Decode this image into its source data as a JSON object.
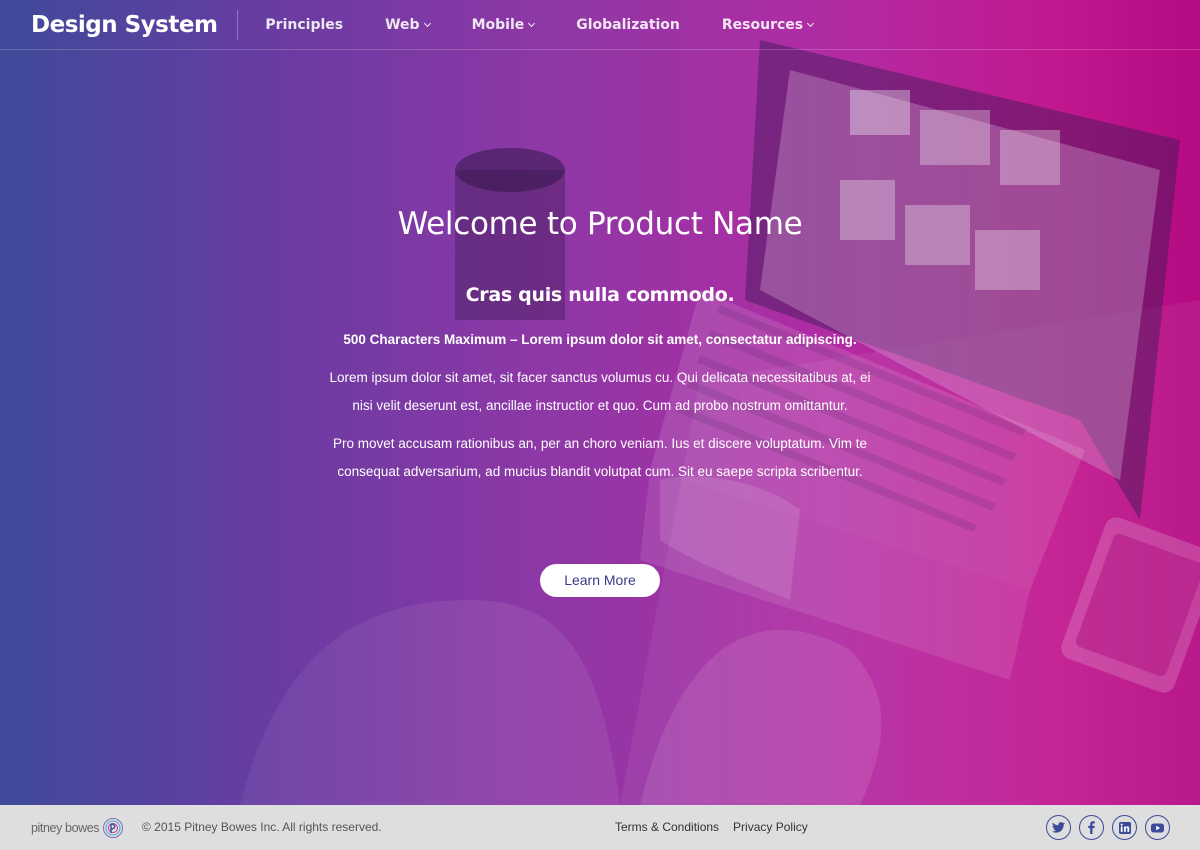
{
  "nav": {
    "brand": "Design System",
    "items": [
      {
        "label": "Principles",
        "dropdown": false
      },
      {
        "label": "Web",
        "dropdown": true
      },
      {
        "label": "Mobile",
        "dropdown": true
      },
      {
        "label": "Globalization",
        "dropdown": false
      },
      {
        "label": "Resources",
        "dropdown": true
      }
    ]
  },
  "hero": {
    "title": "Welcome to Product Name",
    "subtitle": "Cras quis nulla commodo.",
    "lead": "500 Characters Maximum – Lorem ipsum dolor sit amet, consectatur adipiscing.",
    "paragraph1": "Lorem ipsum dolor sit amet, sit facer sanctus volumus cu. Qui delicata necessitatibus at, ei nisi velit deserunt est, ancillae instructior et quo. Cum ad probo nostrum omittantur.",
    "paragraph2": "Pro movet accusam rationibus an, per an choro veniam. Ius et discere voluptatum. Vim te consequat adversarium, ad mucius blandit volutpat cum. Sit eu saepe scripta scribentur.",
    "button": "Learn More"
  },
  "footer": {
    "logo_text": "pitney bowes",
    "copyright": "© 2015 Pitney Bowes Inc. All rights reserved.",
    "links": [
      "Terms & Conditions",
      "Privacy Policy"
    ],
    "social": [
      "twitter-icon",
      "facebook-icon",
      "linkedin-icon",
      "youtube-icon"
    ],
    "social_color": "#3b4a9a"
  },
  "colors": {
    "gradient_start": "#3f4a9a",
    "gradient_end": "#b40a82",
    "footer_bg": "#dedede"
  }
}
